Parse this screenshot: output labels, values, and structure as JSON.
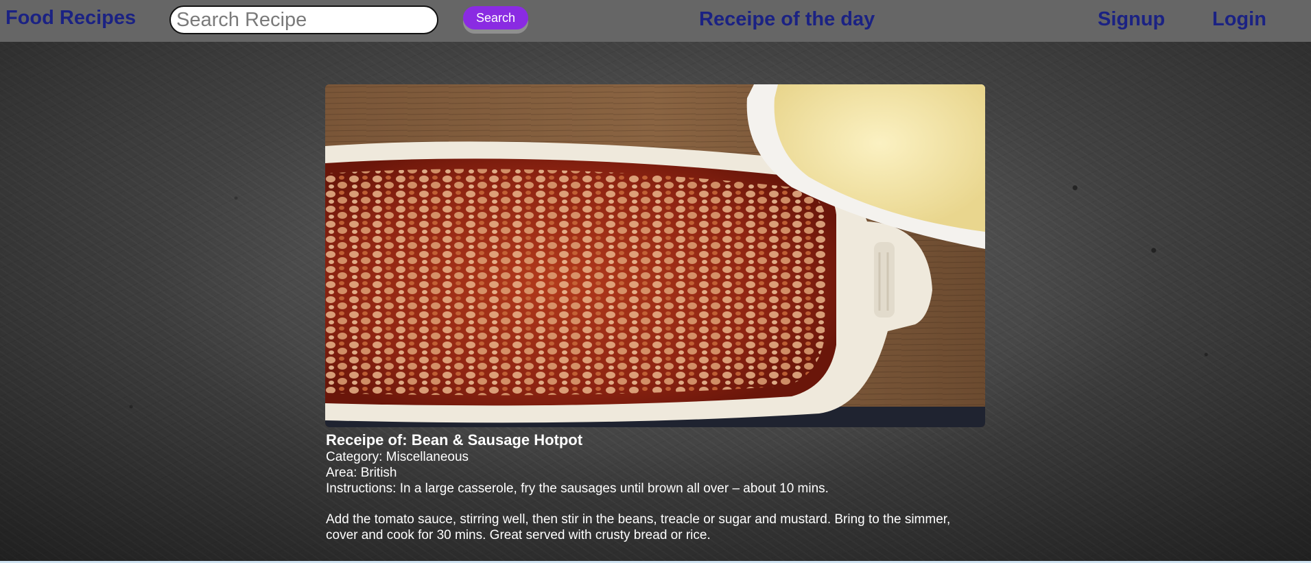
{
  "navbar": {
    "brand": "Food Recipes",
    "search_placeholder": "Search Recipe",
    "search_button": "Search",
    "center_link": "Receipe of the day",
    "signup": "Signup",
    "login": "Login",
    "background_color": "#666666",
    "link_color": "#1b2283",
    "button_color": "#8a2be2"
  },
  "recipe": {
    "image_alt": "Bean & Sausage Hotpot",
    "title": "Receipe of: Bean & Sausage Hotpot",
    "category": "Category: Miscellaneous",
    "area": "Area: British",
    "instructions_line1": "Instructions: In a large casserole, fry the sausages until brown all over – about 10 mins.",
    "instructions_line2": "Add the tomato sauce, stirring well, then stir in the beans, treacle or sugar and mustard. Bring to the simmer,",
    "instructions_line3": "cover and cook for 30 mins. Great served with crusty bread or rice."
  }
}
